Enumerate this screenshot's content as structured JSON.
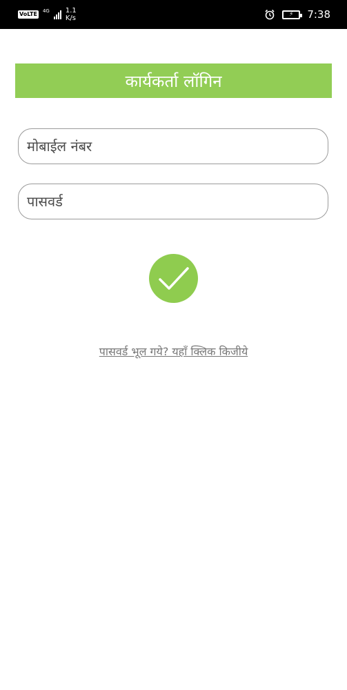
{
  "status_bar": {
    "volte": "VoLTE",
    "network": "4G",
    "speed_value": "1.1",
    "speed_unit": "K/s",
    "time": "7:38"
  },
  "header": {
    "title": "कार्यकर्ता लॉगिन"
  },
  "form": {
    "mobile_placeholder": "मोबाईल नंबर",
    "password_placeholder": "पासवर्ड"
  },
  "forgot_password_link": "पासवर्ड भूल गये? यहाँ क्लिक किजीये",
  "colors": {
    "accent": "#92cd55",
    "status_bar": "#000000"
  },
  "icons": {
    "submit": "checkmark-icon",
    "alarm": "alarm-icon",
    "battery": "battery-charging-icon",
    "signal": "signal-icon"
  }
}
